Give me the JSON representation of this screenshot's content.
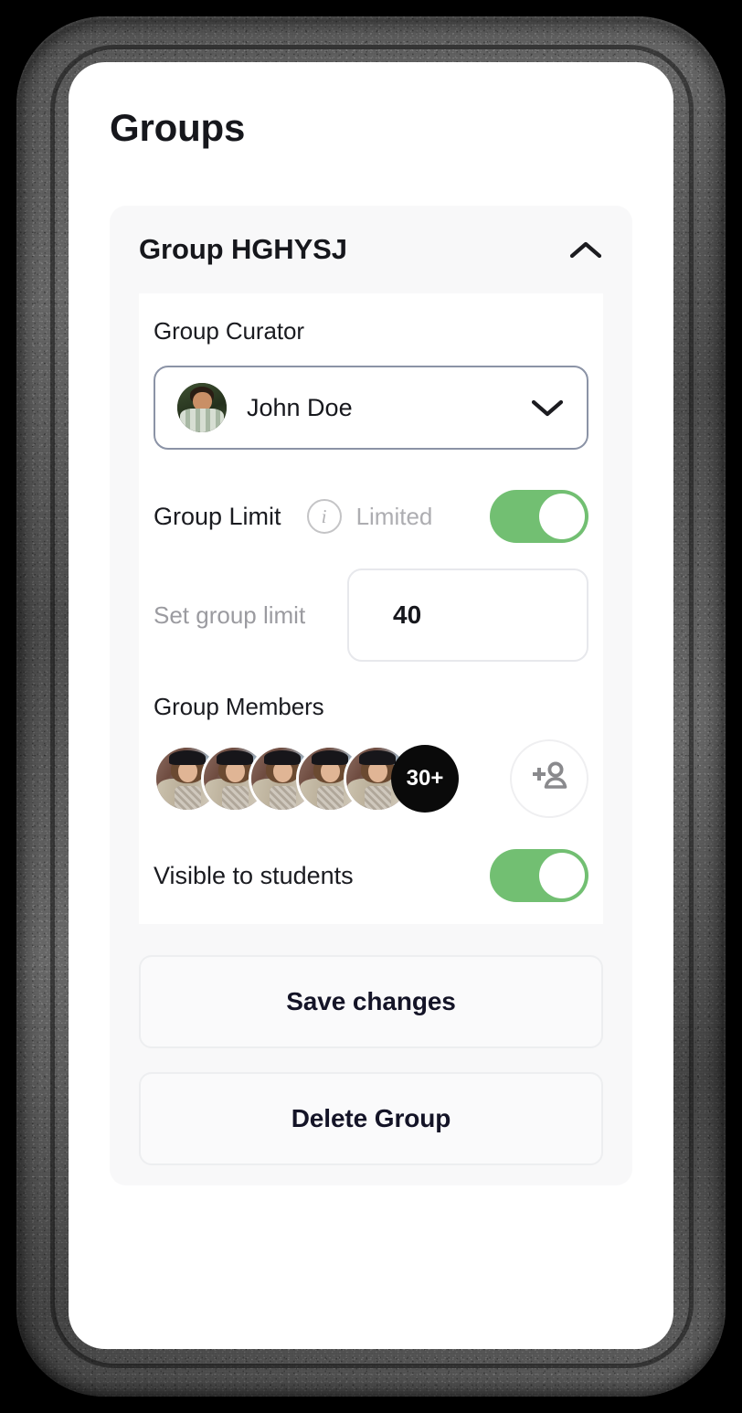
{
  "page": {
    "title": "Groups"
  },
  "group_card": {
    "title": "Group HGHYSJ",
    "collapse_icon": "chevron-up-icon",
    "expanded": true
  },
  "curator": {
    "label": "Group Curator",
    "selected_name": "John Doe",
    "avatar": "avatar-john-doe",
    "dropdown_icon": "chevron-down-icon",
    "border_color": "#8b93a6"
  },
  "group_limit": {
    "label": "Group Limit",
    "info_icon": "info-icon",
    "info_glyph": "i",
    "status_text": "Limited",
    "toggle_on": true,
    "toggle_color": "#72bf72"
  },
  "set_limit": {
    "label": "Set group limit",
    "value": "40",
    "placeholder": "40"
  },
  "members": {
    "label": "Group Members",
    "avatars": [
      "member-avatar-1",
      "member-avatar-2",
      "member-avatar-3",
      "member-avatar-4",
      "member-avatar-5"
    ],
    "overflow_count": "30+",
    "add_icon": "person-add-icon"
  },
  "visibility": {
    "label": "Visible to students",
    "toggle_on": true,
    "toggle_color": "#72bf72"
  },
  "actions": {
    "save_label": "Save changes",
    "delete_label": "Delete Group"
  }
}
